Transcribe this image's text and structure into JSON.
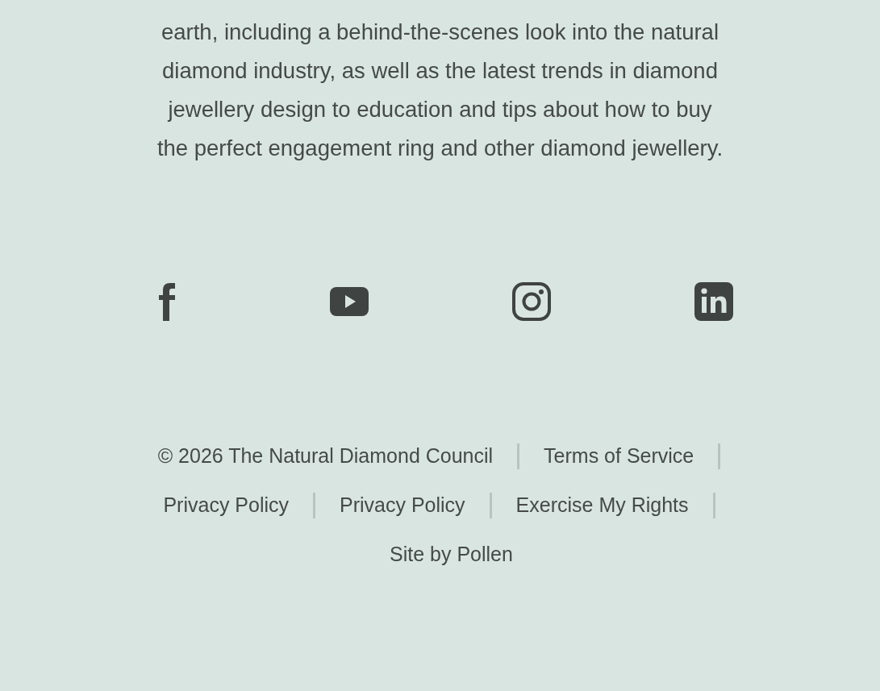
{
  "intro": {
    "lines": [
      "earth, including a behind-the-scenes look into the natural",
      "diamond industry, as well as the latest trends in diamond",
      "jewellery design to education and tips about how to buy",
      "the perfect engagement ring and other diamond jewellery."
    ]
  },
  "social": [
    {
      "kind": "facebook"
    },
    {
      "kind": "youtube"
    },
    {
      "kind": "instagram"
    },
    {
      "kind": "linkedin"
    }
  ],
  "footer": {
    "links": [
      "© 2026 The Natural Diamond Council",
      "Terms of Service",
      "Privacy Policy",
      "Privacy Policy",
      "Exercise My Rights"
    ],
    "credit": "Site by Pollen"
  }
}
